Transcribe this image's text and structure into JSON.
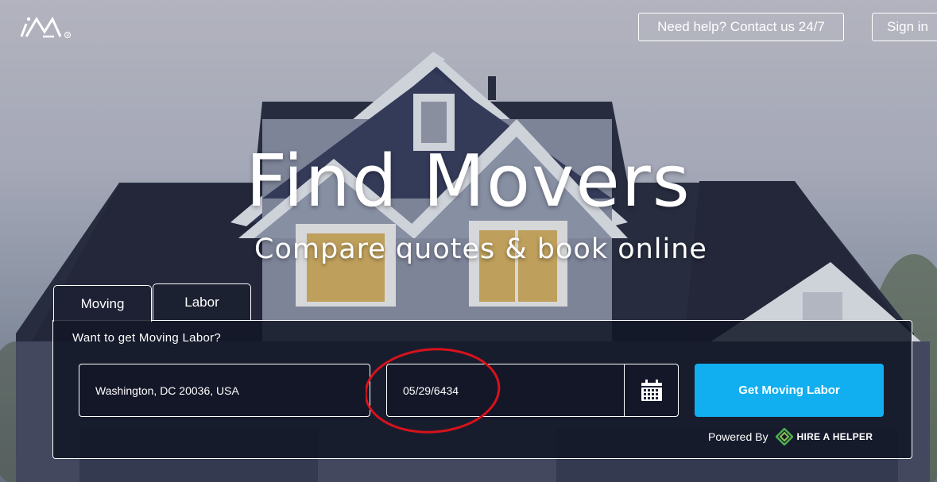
{
  "header": {
    "logo_alt": "iM logo",
    "help_label": "Need help? Contact us 24/7",
    "signin_label": "Sign in"
  },
  "hero": {
    "title": "Find Movers",
    "subtitle": "Compare quotes & book online"
  },
  "tabs": [
    {
      "label": "Moving",
      "active": true
    },
    {
      "label": "Labor",
      "active": false
    }
  ],
  "form": {
    "question": "Want to get Moving Labor?",
    "address_value": "Washington, DC 20036, USA",
    "date_value": "05/29/6434",
    "cta_label": "Get Moving Labor",
    "powered_by": "Powered By",
    "partner_name": "HIRE A HELPER"
  },
  "colors": {
    "accent": "#11aef0",
    "panel": "#121626",
    "annotation": "#d8121b",
    "partner_green": "#4caf50"
  },
  "icons": {
    "calendar": "calendar-icon",
    "logo": "im-logo-icon",
    "partner": "hire-a-helper-icon"
  }
}
